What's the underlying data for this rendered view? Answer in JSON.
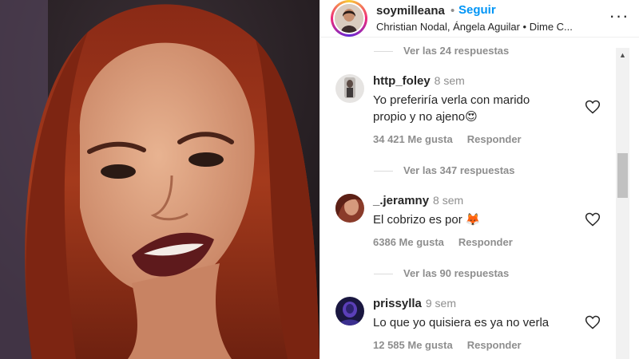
{
  "post": {
    "owner": "soymilleana",
    "separator": "•",
    "follow_label": "Seguir",
    "audio_line": "Christian Nodal, Ángela Aguilar • Dime C...",
    "more_label": "···"
  },
  "comments": [
    {
      "username": "http_foley",
      "time": "8 sem",
      "text_line1": "Yo preferiría verla con marido",
      "text_line2": "propio y no ajeno",
      "emoji": "😍",
      "likes": "34 421 Me gusta",
      "reply_label": "Responder",
      "view_replies": "Ver las 347 respuestas"
    },
    {
      "username": "_.jeramny",
      "time": "8 sem",
      "text_line1": "El cobrizo es por",
      "emoji": "🦊",
      "likes": "6386 Me gusta",
      "reply_label": "Responder",
      "view_replies": "Ver las 90 respuestas"
    },
    {
      "username": "prissylla",
      "time": "9 sem",
      "text_line1": "Lo que yo quisiera es ya no verla",
      "likes": "12 585 Me gusta",
      "reply_label": "Responder"
    }
  ],
  "top_replies_label": "Ver las 24 respuestas",
  "icons": {
    "heart": "heart-outline-icon",
    "more": "more-horizontal-icon",
    "scroll_up": "scroll-up-arrow-icon"
  },
  "colors": {
    "link_blue": "#0095f6",
    "muted": "#8e8e8e",
    "text": "#262626"
  }
}
